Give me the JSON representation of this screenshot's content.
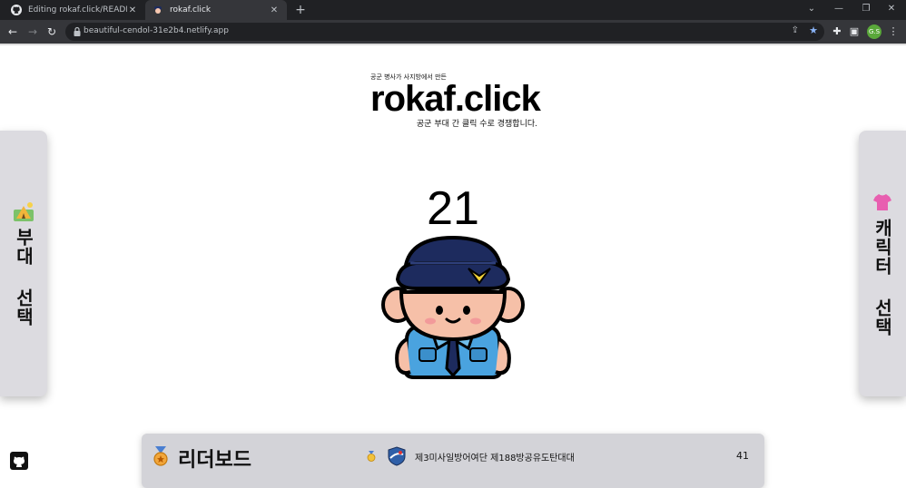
{
  "browser": {
    "tabs": [
      {
        "title": "Editing rokaf.click/README.md",
        "close": "✕"
      },
      {
        "title": "rokaf.click",
        "close": "✕"
      }
    ],
    "new_tab": "+",
    "url": "beautiful-cendol-31e2b4.netlify.app",
    "profile_initials": "G.S"
  },
  "header": {
    "tagline": "공군 병사가 사지방에서 만든",
    "logo": "rokaf.click",
    "subtitle": "공군 부대 간 클릭 수로 경쟁합니다."
  },
  "left_panel": {
    "label": "부대 선택",
    "icon": "camp-icon"
  },
  "right_panel": {
    "label": "캐릭터 선택",
    "icon": "shirt-icon"
  },
  "counter": "21",
  "leaderboard": {
    "title": "리더보드",
    "top_unit": "제3미사일방어여단 제188방공유도탄대대",
    "top_score": "41"
  },
  "colors": {
    "panel_bg": "#dcdbe0",
    "leaderboard_bg": "#d3d3d8",
    "uniform_blue": "#4aa3df",
    "cap_navy": "#1d2b5e",
    "badge_yellow": "#f2d23a"
  }
}
